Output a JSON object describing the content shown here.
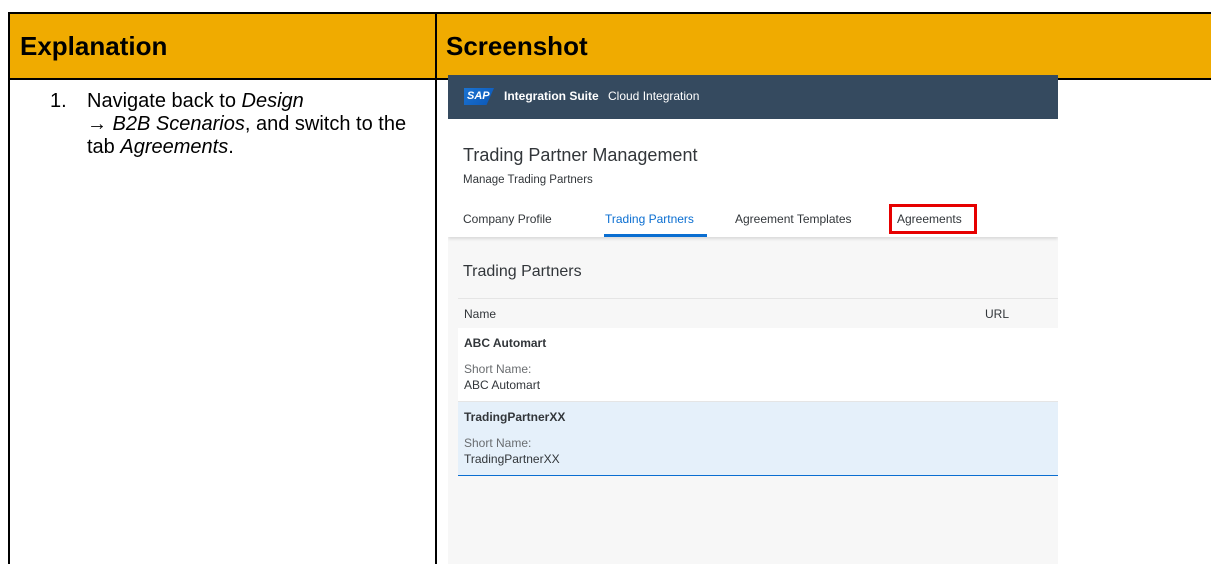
{
  "header": {
    "col1": "Explanation",
    "col2": "Screenshot"
  },
  "step": {
    "number": "1.",
    "text_a": "Navigate back to ",
    "text_b": "Design",
    "text_c": "→ B2B Scenarios",
    "text_d": ", and switch to the tab ",
    "text_e": "Agreements",
    "text_f": "."
  },
  "screenshot": {
    "shell": {
      "logo": "SAP",
      "product": "Integration Suite",
      "app": "Cloud Integration"
    },
    "page": {
      "title": "Trading Partner Management",
      "subtitle": "Manage Trading Partners"
    },
    "tabs": [
      {
        "label": "Company Profile"
      },
      {
        "label": "Trading Partners"
      },
      {
        "label": "Agreement Templates"
      },
      {
        "label": "Agreements"
      }
    ],
    "active_tab": "Trading Partners",
    "highlighted_tab": "Agreements",
    "section_title": "Trading Partners",
    "columns": [
      "Name",
      "URL"
    ],
    "rows": [
      {
        "name": "ABC Automart",
        "short_label": "Short Name:",
        "short_value": "ABC Automart"
      },
      {
        "name": "TradingPartnerXX",
        "short_label": "Short Name:",
        "short_value": "TradingPartnerXX"
      }
    ],
    "colors": {
      "header_bg": "#f0ab00",
      "shell_bg": "#354a5f",
      "accent": "#0a6ed1",
      "highlight": "#e60000",
      "selected_row": "#e5f0fa"
    }
  }
}
